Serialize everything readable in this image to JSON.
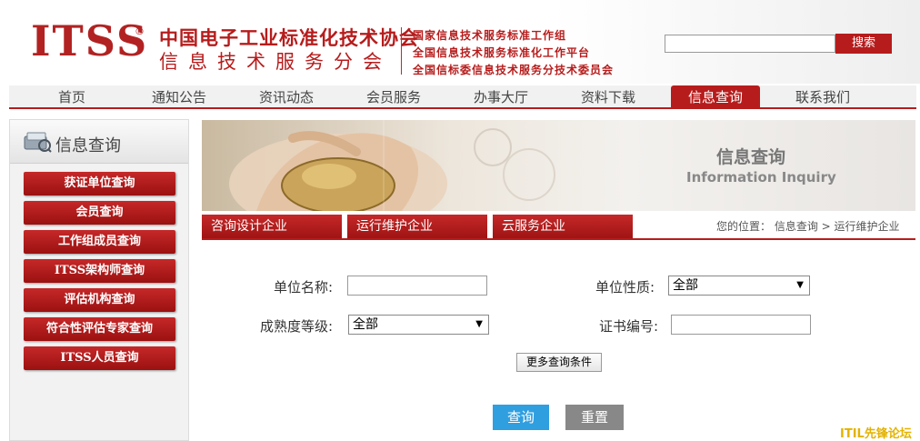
{
  "header": {
    "logo": "ITSS",
    "logo_mark": "®",
    "org_line1": "中国电子工业标准化技术协会",
    "org_line2": "信息技术服务分会",
    "sub_lines": [
      "国家信息技术服务标准工作组",
      "全国信息技术服务标准化工作平台",
      "全国信标委信息技术服务分技术委员会"
    ],
    "search_placeholder": "",
    "search_button": "搜索"
  },
  "nav": {
    "items": [
      "首页",
      "通知公告",
      "资讯动态",
      "会员服务",
      "办事大厅",
      "资料下载",
      "信息查询",
      "联系我们"
    ],
    "active_index": 6
  },
  "sidebar": {
    "title": "信息查询",
    "buttons": [
      "获证单位查询",
      "会员查询",
      "工作组成员查询",
      "ITSS架构师查询",
      "评估机构查询",
      "符合性评估专家查询",
      "ITSS人员查询"
    ]
  },
  "banner": {
    "title": "信息查询",
    "subtitle": "Information Inquiry"
  },
  "tabs": {
    "items": [
      "咨询设计企业",
      "运行维护企业",
      "云服务企业"
    ],
    "breadcrumb": "您的位置： 信息查询 > 运行维护企业"
  },
  "form": {
    "unit_name_label": "单位名称:",
    "unit_name_value": "",
    "unit_type_label": "单位性质:",
    "unit_type_value": "全部",
    "maturity_label": "成熟度等级:",
    "maturity_value": "全部",
    "cert_no_label": "证书编号:",
    "cert_no_value": "",
    "more_button": "更多查询条件",
    "query_button": "查询",
    "reset_button": "重置"
  },
  "watermark": "ITIL先锋论坛",
  "colors": {
    "brand_red": "#b71c1c",
    "query_blue": "#2f9fe0",
    "reset_gray": "#888888"
  }
}
